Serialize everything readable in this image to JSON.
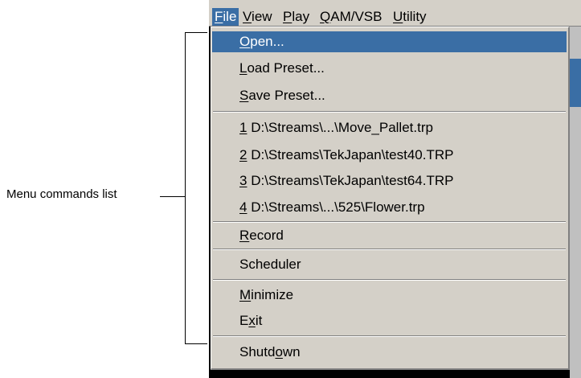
{
  "annotation": {
    "label": "Menu commands list"
  },
  "menubar": {
    "items": [
      {
        "label": "File",
        "active": true
      },
      {
        "label": "View"
      },
      {
        "label": "Play"
      },
      {
        "label": "QAM/VSB"
      },
      {
        "label": "Utility"
      }
    ]
  },
  "file_menu": {
    "items": [
      {
        "label": "Open...",
        "highlighted": true
      },
      {
        "label": "Load Preset..."
      },
      {
        "label": "Save Preset..."
      },
      {
        "number": "1",
        "path": " D:\\Streams\\...\\Move_Pallet.trp"
      },
      {
        "number": "2",
        "path": " D:\\Streams\\TekJapan\\test40.TRP"
      },
      {
        "number": "3",
        "path": " D:\\Streams\\TekJapan\\test64.TRP"
      },
      {
        "number": "4",
        "path": " D:\\Streams\\...\\525\\Flower.trp"
      },
      {
        "label": "Record"
      },
      {
        "label": "Scheduler"
      },
      {
        "label": "Minimize"
      },
      {
        "label": "Exit"
      },
      {
        "label": "Shutdown"
      }
    ]
  },
  "colors": {
    "highlight": "#3a6ea5",
    "menu_face": "#d4d0c8"
  }
}
